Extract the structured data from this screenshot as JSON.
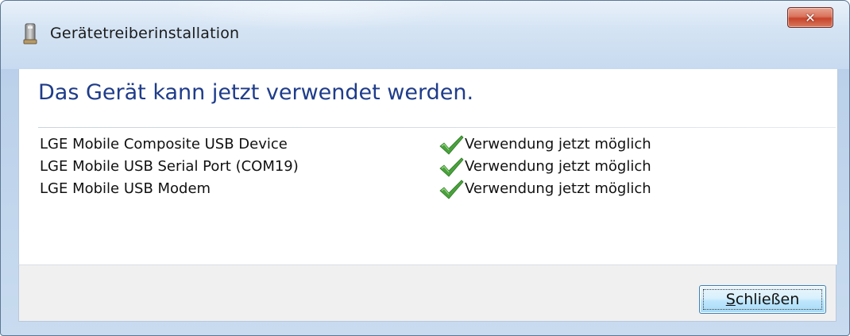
{
  "window": {
    "title": "Gerätetreiberinstallation",
    "close_glyph": "✕"
  },
  "main": {
    "heading": "Das Gerät kann jetzt verwendet werden.",
    "devices": [
      {
        "name": "LGE Mobile Composite USB Device",
        "status": "Verwendung jetzt möglich",
        "status_icon": "green-check-icon"
      },
      {
        "name": "LGE Mobile USB Serial Port (COM19)",
        "status": "Verwendung jetzt möglich",
        "status_icon": "green-check-icon"
      },
      {
        "name": "LGE Mobile USB Modem",
        "status": "Verwendung jetzt möglich",
        "status_icon": "green-check-icon"
      }
    ]
  },
  "footer": {
    "close_button_mnemonic": "S",
    "close_button_rest": "chließen"
  },
  "colors": {
    "heading": "#1f3c8a",
    "check": "#4aa23c",
    "close_button_border": "#3c7fb1",
    "title_close": "#c7432a"
  }
}
